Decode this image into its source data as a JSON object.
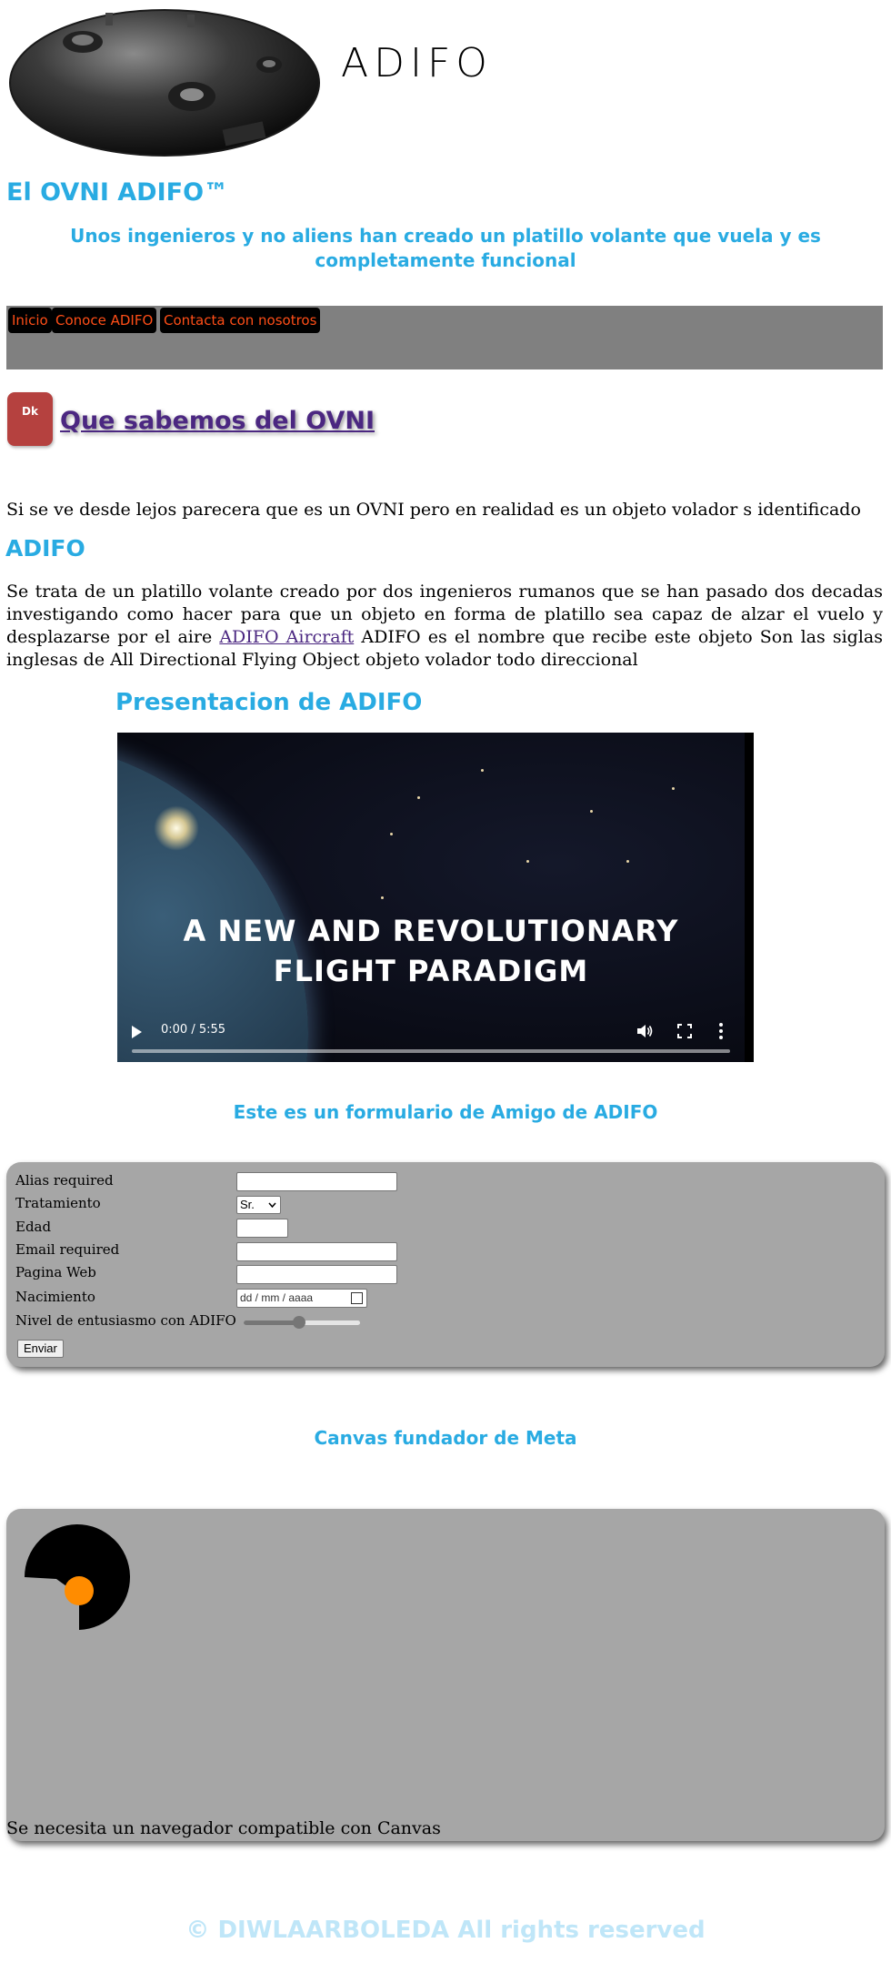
{
  "header": {
    "brand": "ADIFO",
    "title": "El OVNI ADIFO™",
    "tagline": "Unos ingenieros  y no aliens  han creado un platillo volante que vuela y es completamente funcional"
  },
  "nav": {
    "items": [
      {
        "label": "Inicio"
      },
      {
        "label": "Conoce ADIFO"
      },
      {
        "label": "Contacta con nosotros"
      }
    ]
  },
  "section": {
    "badge": "Dk",
    "heading": "Que sabemos del OVNI",
    "intro": "Si se ve desde lejos parecera que es un OVNI  pero en realidad es un objeto volador s  identificado",
    "adifo_heading": "ADIFO",
    "description_before_link": "Se trata de un platillo volante creado por dos ingenieros rumanos que se han pasado dos decadas investigando como hacer para que un objeto en forma de platillo sea capaz de alzar el vuelo y desplazarse por el aire ",
    "link_label": "ADIFO Aircraft",
    "description_after_link": " ADIFO es el nombre que recibe este objeto  Son las siglas inglesas de All Directional Flying Object  objeto volador todo direccional"
  },
  "video": {
    "heading": "Presentacion de ADIFO",
    "caption_line1": "A NEW AND REVOLUTIONARY",
    "caption_line2": "FLIGHT PARADIGM",
    "time": "0:00 / 5:55",
    "progress": 0
  },
  "form": {
    "heading": "Este es un formulario de Amigo de ADIFO",
    "alias_label": "Alias  required",
    "tratamiento_label": "Tratamiento",
    "tratamiento_value": "Sr.",
    "edad_label": "Edad",
    "email_label": "Email  required",
    "web_label": "Pagina Web",
    "nacimiento_label": "Nacimiento",
    "nacimiento_placeholder": "dd / mm / aaaa",
    "entusiasmo_label": "Nivel de entusiasmo con ADIFO",
    "entusiasmo_level": 0.48,
    "submit_label": "Enviar"
  },
  "canvas": {
    "heading": "Canvas fundador de Meta",
    "fallback": "Se necesita un navegador compatible con Canvas",
    "logo_colors": {
      "shape": "#000000",
      "dot": "#ff8c00"
    }
  },
  "footer": {
    "text": "©          DIWLAARBOLEDA All rights reserved"
  }
}
